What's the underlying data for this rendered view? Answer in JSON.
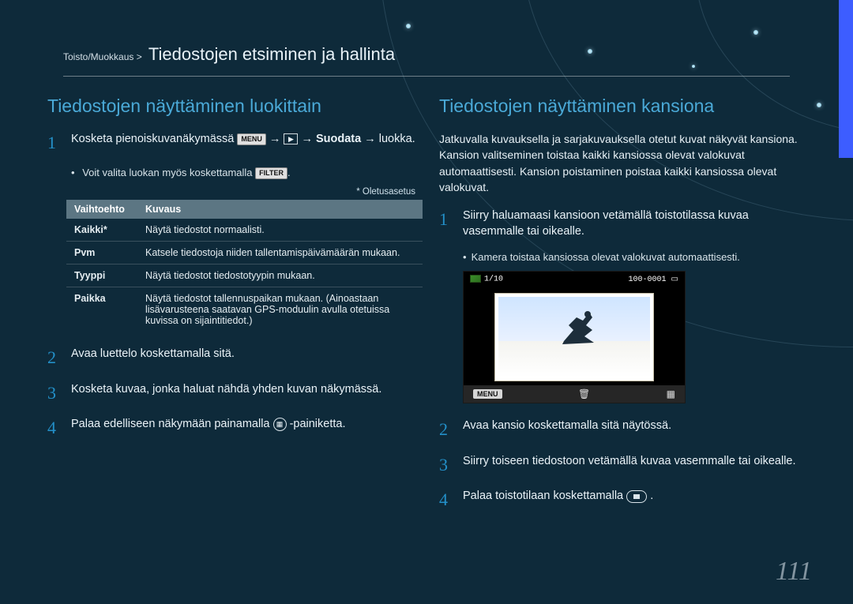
{
  "header": {
    "breadcrumb": "Toisto/Muokkaus >",
    "title": "Tiedostojen etsiminen ja hallinta"
  },
  "left": {
    "heading": "Tiedostojen näyttäminen luokittain",
    "step1_a": "Kosketa pienoiskuvanäkymässä ",
    "step1_menu": "MENU",
    "step1_arrow": " → ",
    "step1_suodata": "Suodata",
    "step1_c": " → luokka.",
    "sub1": "Voit valita luokan myös koskettamalla ",
    "filter_label": "FILTER",
    "note": "* Oletusasetus",
    "table_h1": "Vaihtoehto",
    "table_h2": "Kuvaus",
    "rows": [
      {
        "k": "Kaikki*",
        "v": "Näytä tiedostot normaalisti."
      },
      {
        "k": "Pvm",
        "v": "Katsele tiedostoja niiden tallentamispäivämäärän mukaan."
      },
      {
        "k": "Tyyppi",
        "v": "Näytä tiedostot tiedostotyypin mukaan."
      },
      {
        "k": "Paikka",
        "v": "Näytä tiedostot tallennuspaikan mukaan. (Ainoastaan lisävarusteena saatavan GPS-moduulin avulla otetuissa kuvissa on sijaintitiedot.)"
      }
    ],
    "step2": "Avaa luettelo koskettamalla sitä.",
    "step3": "Kosketa kuvaa, jonka haluat nähdä yhden kuvan näkymässä.",
    "step4_a": "Palaa edelliseen näkymään painamalla ",
    "step4_b": "-painiketta."
  },
  "right": {
    "heading": "Tiedostojen näyttäminen kansiona",
    "intro": "Jatkuvalla kuvauksella ja sarjakuvauksella otetut kuvat näkyvät kansiona. Kansion valitseminen toistaa kaikki kansiossa olevat valokuvat automaattisesti. Kansion poistaminen poistaa kaikki kansiossa olevat valokuvat.",
    "step1": "Siirry haluamaasi kansioon vetämällä toistotilassa kuvaa vasemmalle tai oikealle.",
    "sub1": "Kamera toistaa kansiossa olevat valokuvat automaattisesti.",
    "preview": {
      "counter": "1/10",
      "fileno": "100-0001",
      "menu": "MENU"
    },
    "step2": "Avaa kansio koskettamalla sitä näytössä.",
    "step3": "Siirry toiseen tiedostoon vetämällä kuvaa vasemmalle tai oikealle.",
    "step4_a": "Palaa toistotilaan koskettamalla ",
    "step4_b": "."
  },
  "page": "111"
}
